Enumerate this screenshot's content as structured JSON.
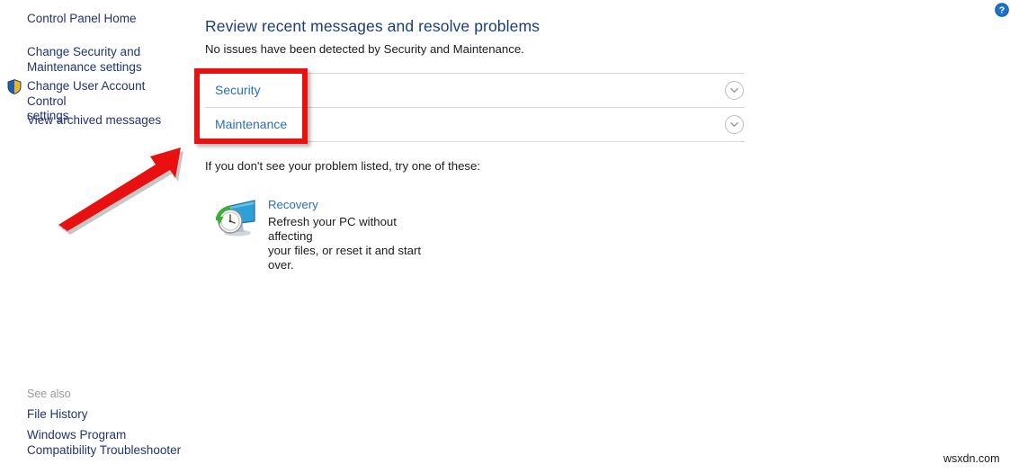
{
  "sidebar": {
    "links": [
      {
        "id": "cp-home",
        "label": "Control Panel Home"
      },
      {
        "id": "change-security-maintenance",
        "label": "Change Security and\nMaintenance settings"
      },
      {
        "id": "change-uac",
        "label": "Change User Account Control\nsettings",
        "icon": "uac-shield-icon"
      },
      {
        "id": "view-archived",
        "label": "View archived messages"
      }
    ],
    "see_also": {
      "heading": "See also",
      "links": [
        {
          "id": "file-history",
          "label": "File History"
        },
        {
          "id": "windows-program-compatibility-troubleshooter",
          "label": "Windows Program\nCompatibility Troubleshooter"
        }
      ]
    }
  },
  "main": {
    "title": "Review recent messages and resolve problems",
    "subtitle": "No issues have been detected by Security and Maintenance.",
    "expanders": [
      {
        "id": "security",
        "label": "Security",
        "chevron": "chevron-down-icon",
        "state": "collapsed"
      },
      {
        "id": "maintenance",
        "label": "Maintenance",
        "chevron": "chevron-down-icon",
        "state": "collapsed"
      }
    ],
    "try_text": "If you don't see your problem listed, try one of these:",
    "recovery": {
      "icon": "recovery-icon",
      "link_label": "Recovery",
      "description": "Refresh your PC without affecting\nyour files, or reset it and start over."
    }
  },
  "help": {
    "icon": "help-question-icon",
    "label": "?"
  },
  "annotations": {
    "highlight_box": {
      "color": "#E81010"
    },
    "arrow": {
      "color": "#E81010",
      "icon": "arrow-up-right-icon"
    }
  },
  "watermark": {
    "text": "wsxdn.com"
  },
  "colors": {
    "sidebar_link": "#22356B",
    "title": "#1A3E7C",
    "body_text": "#1C1C1C",
    "expander_link": "#2A6FB5",
    "see_also_heading": "#9A9A9A",
    "separator": "#D6D6D6",
    "annotation_red": "#E81010",
    "help_blue": "#1D74C4"
  }
}
